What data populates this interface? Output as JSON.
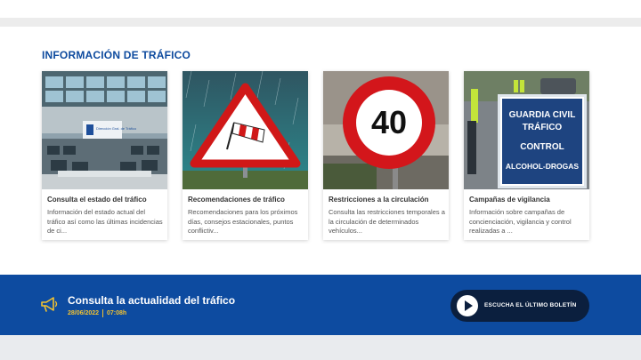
{
  "section": {
    "title": "INFORMACIÓN DE TRÁFICO"
  },
  "cards": [
    {
      "title": "Consulta el estado del tráfico",
      "description": "Información del estado actual del tráfico así como las últimas incidencias de ci..."
    },
    {
      "title": "Recomendaciones de tráfico",
      "description": "Recomendaciones para los próximos días, consejos estacionales, puntos conflictiv..."
    },
    {
      "title": "Restricciones a la circulación",
      "description": "Consulta las restricciones temporales a la circulación de determinados vehículos..."
    },
    {
      "title": "Campañas de vigilancia",
      "description": "Información sobre campañas de concienciación, vigilancia y control realizadas a ..."
    }
  ],
  "images": {
    "control_room_sign": "Dirección Gral. de Tráfico",
    "speed_limit": "40",
    "guardia_sign": [
      "GUARDIA CIVIL",
      "TRÁFICO",
      "CONTROL",
      "ALCOHOL-DROGAS"
    ]
  },
  "banner": {
    "title": "Consulta la actualidad del tráfico",
    "date": "28/06/2022",
    "time": "07:08h",
    "listen_label": "ESCUCHA EL ÚLTIMO BOLETÍN"
  },
  "colors": {
    "brand_blue": "#0d4ba0",
    "accent_yellow": "#f2c230",
    "button_dark": "#0b1f3e"
  }
}
